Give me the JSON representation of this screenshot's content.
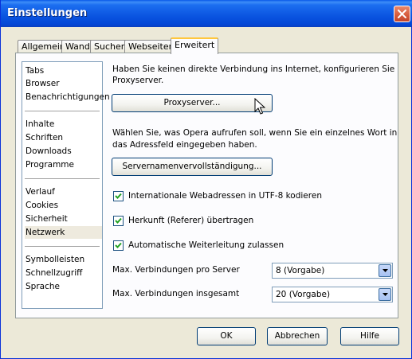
{
  "window": {
    "title": "Einstellungen",
    "close_icon": "close-icon"
  },
  "tabs": [
    {
      "label": "Allgemein"
    },
    {
      "label": "Wand"
    },
    {
      "label": "Suchen"
    },
    {
      "label": "Webseiten"
    },
    {
      "label": "Erweitert",
      "active": true
    }
  ],
  "sidebar": {
    "items": [
      {
        "label": "Tabs"
      },
      {
        "label": "Browser"
      },
      {
        "label": "Benachrichtigungen"
      },
      {
        "label": "Inhalte"
      },
      {
        "label": "Schriften"
      },
      {
        "label": "Downloads"
      },
      {
        "label": "Programme"
      },
      {
        "label": "Verlauf"
      },
      {
        "label": "Cookies"
      },
      {
        "label": "Sicherheit"
      },
      {
        "label": "Netzwerk",
        "selected": true
      },
      {
        "label": "Symbolleisten"
      },
      {
        "label": "Schnellzugriff"
      },
      {
        "label": "Sprache"
      }
    ]
  },
  "network": {
    "proxy_text_1": "Haben Sie keinen direkte Verbindung ins Internet, konfigurieren Sie",
    "proxy_text_2": "Proxyserver.",
    "proxy_button": "Proxyserver...",
    "server_text_1": "Wählen Sie, was Opera aufrufen soll, wenn Sie ein einzelnes Wort in",
    "server_text_2": "das Adressfeld eingegeben haben.",
    "server_button": "Servernamenvervollständigung...",
    "checkboxes": [
      {
        "label": "Internationale Webadressen in UTF-8 kodieren",
        "checked": true
      },
      {
        "label": "Herkunft (Referer) übertragen",
        "checked": true
      },
      {
        "label": "Automatische Weiterleitung zulassen",
        "checked": true
      }
    ],
    "max_per_server_label": "Max. Verbindungen pro Server",
    "max_per_server_value": "8 (Vorgabe)",
    "max_total_label": "Max. Verbindungen insgesamt",
    "max_total_value": "20 (Vorgabe)"
  },
  "footer": {
    "ok": "OK",
    "cancel": "Abbrechen",
    "help": "Hilfe"
  },
  "colors": {
    "title_bar": "#0a54e0",
    "dialog_bg": "#ece9d8",
    "active_tab_accent": "#ffc73c",
    "selection_bg": "#eeeade"
  }
}
